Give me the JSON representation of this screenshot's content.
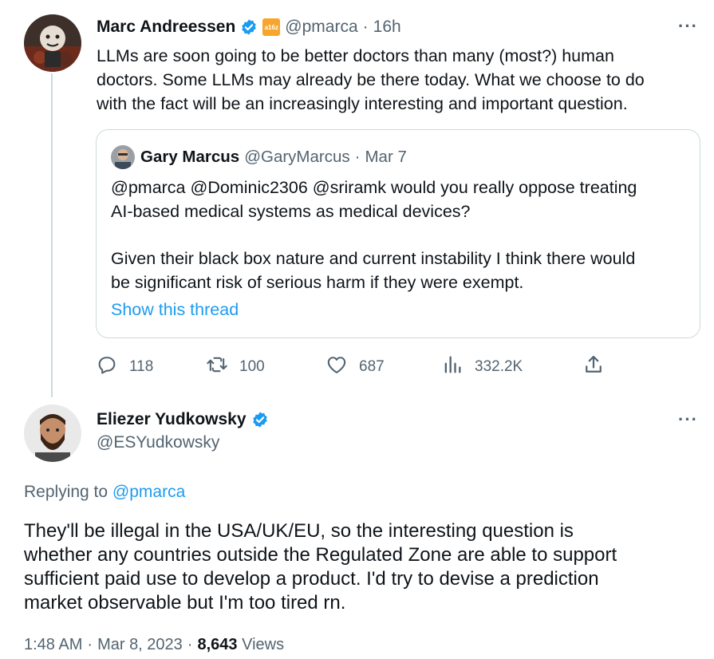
{
  "tweet": {
    "author_name": "Marc Andreessen",
    "badge_text": "a16z",
    "handle": "@pmarca",
    "separator": "·",
    "time": "16h",
    "text": "LLMs are soon going to be better doctors than many (most?) human\ndoctors. Some LLMs may already be there today. What we choose to do\nwith the fact will be an increasingly interesting and important question.",
    "more": "···"
  },
  "quote": {
    "author_name": "Gary Marcus",
    "handle": "@GaryMarcus",
    "separator": "·",
    "date": "Mar 7",
    "text_1": "@pmarca @Dominic2306 @sriramk would you really oppose treating\nAI-based medical systems as medical devices?",
    "text_2": "Given their black box nature and current instability I think there would\nbe significant risk of serious harm if they were exempt.",
    "show_thread": "Show this thread"
  },
  "actions": {
    "replies": "118",
    "retweets": "100",
    "likes": "687",
    "views": "332.2K"
  },
  "reply": {
    "author_name": "Eliezer Yudkowsky",
    "handle": "@ESYudkowsky",
    "more": "···",
    "replying_to_label": "Replying to",
    "replying_to_handle": "@pmarca",
    "text": "They'll be illegal in the USA/UK/EU, so the interesting question is\nwhether any countries outside the Regulated Zone are able to support\nsufficient paid use to develop a product.  I'd try to devise a prediction\nmarket observable but I'm too tired rn.",
    "time": "1:48 AM",
    "separator_1": "·",
    "date": "Mar 8, 2023",
    "separator_2": "·",
    "views_count": "8,643",
    "views_label": "Views"
  },
  "colors": {
    "verified": "#1d9bf0",
    "link": "#1d9bf0",
    "secondary_text": "#536471",
    "badge": "#f7a52b"
  }
}
